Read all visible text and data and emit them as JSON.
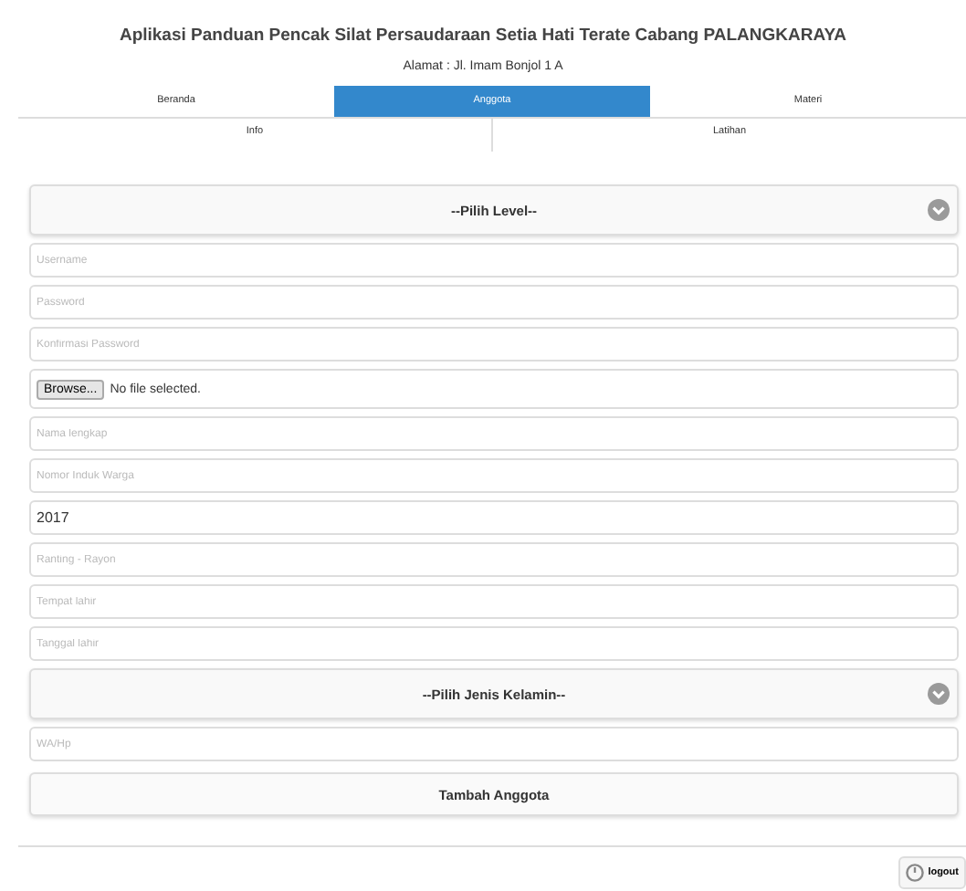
{
  "header": {
    "title": "Aplikasi Panduan Pencak Silat Persaudaraan Setia Hati Terate Cabang PALANGKARAYA",
    "address": "Alamat : Jl. Imam Bonjol 1 A"
  },
  "tabs": [
    {
      "label": "Beranda",
      "selected": false
    },
    {
      "label": "Anggota",
      "selected": true
    },
    {
      "label": "Materi",
      "selected": false
    }
  ],
  "subtabs": [
    {
      "label": "Info",
      "selected": false
    },
    {
      "label": "Latihan",
      "selected": false
    }
  ],
  "form": [
    {
      "kind": "select",
      "label": "--Pilih Level--"
    },
    {
      "kind": "input",
      "placeholder": "Username"
    },
    {
      "kind": "input",
      "placeholder": "Password"
    },
    {
      "kind": "input",
      "placeholder": "Konfirmasi Password"
    },
    {
      "kind": "file",
      "button": "Browse...",
      "status": "No file selected."
    },
    {
      "kind": "input",
      "placeholder": "Nama lengkap"
    },
    {
      "kind": "input",
      "placeholder": "Nomor Induk Warga"
    },
    {
      "kind": "input",
      "value": "2017"
    },
    {
      "kind": "input",
      "placeholder": "Ranting - Rayon"
    },
    {
      "kind": "input",
      "placeholder": "Tempat lahir"
    },
    {
      "kind": "input",
      "placeholder": "Tanggal lahir"
    },
    {
      "kind": "select",
      "label": "--Pilih Jenis Kelamin--"
    },
    {
      "kind": "input",
      "placeholder": "WA/Hp"
    },
    {
      "kind": "submit",
      "label": "Tambah Anggota"
    }
  ],
  "logout": "logout"
}
